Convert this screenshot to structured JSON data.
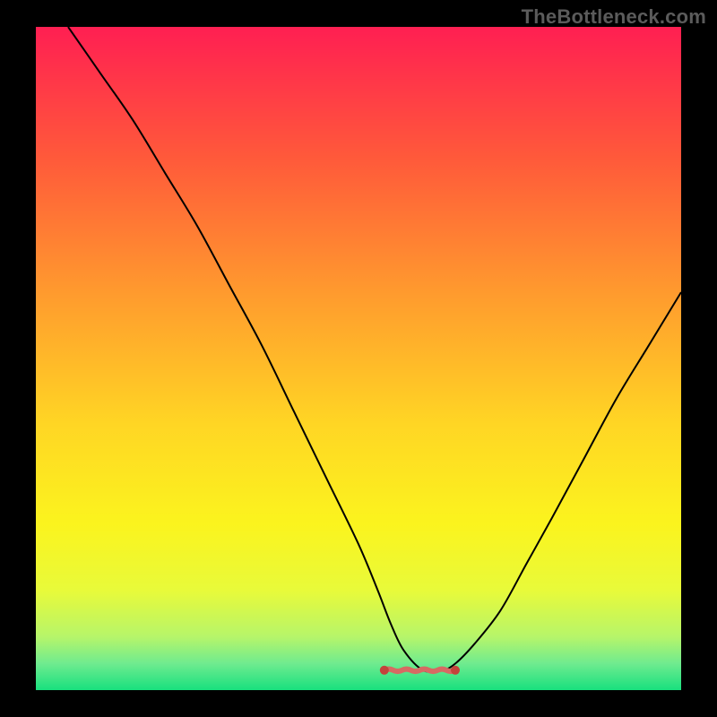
{
  "watermark": "TheBottleneck.com",
  "colors": {
    "frame": "#000000",
    "curve": "#000000",
    "floor_marker": "#D66A63",
    "floor_marker_dot": "#C4433B",
    "gradient_stops": [
      {
        "offset": 0.0,
        "color": "#FF1F52"
      },
      {
        "offset": 0.2,
        "color": "#FF5A3A"
      },
      {
        "offset": 0.4,
        "color": "#FF9A2E"
      },
      {
        "offset": 0.6,
        "color": "#FFD624"
      },
      {
        "offset": 0.75,
        "color": "#FBF41E"
      },
      {
        "offset": 0.85,
        "color": "#E8FA3A"
      },
      {
        "offset": 0.92,
        "color": "#B6F56A"
      },
      {
        "offset": 0.96,
        "color": "#6FEB8F"
      },
      {
        "offset": 1.0,
        "color": "#18E07E"
      }
    ]
  },
  "chart_data": {
    "type": "line",
    "title": "",
    "xlabel": "",
    "ylabel": "",
    "xlim": [
      0,
      100
    ],
    "ylim": [
      0,
      100
    ],
    "grid": false,
    "legend": false,
    "note": "V-shaped bottleneck curve; minimum near x≈60 at y≈3. Floor marker spans x≈54–65 at y≈3.",
    "series": [
      {
        "name": "curve",
        "x": [
          5,
          10,
          15,
          20,
          25,
          30,
          35,
          40,
          45,
          50,
          53,
          55,
          57,
          60,
          63,
          65,
          68,
          72,
          76,
          80,
          85,
          90,
          95,
          100
        ],
        "y": [
          100,
          93,
          86,
          78,
          70,
          61,
          52,
          42,
          32,
          22,
          15,
          10,
          6,
          3,
          3,
          4,
          7,
          12,
          19,
          26,
          35,
          44,
          52,
          60
        ]
      }
    ],
    "floor_marker": {
      "x_start": 54,
      "x_end": 65,
      "y": 3
    }
  }
}
